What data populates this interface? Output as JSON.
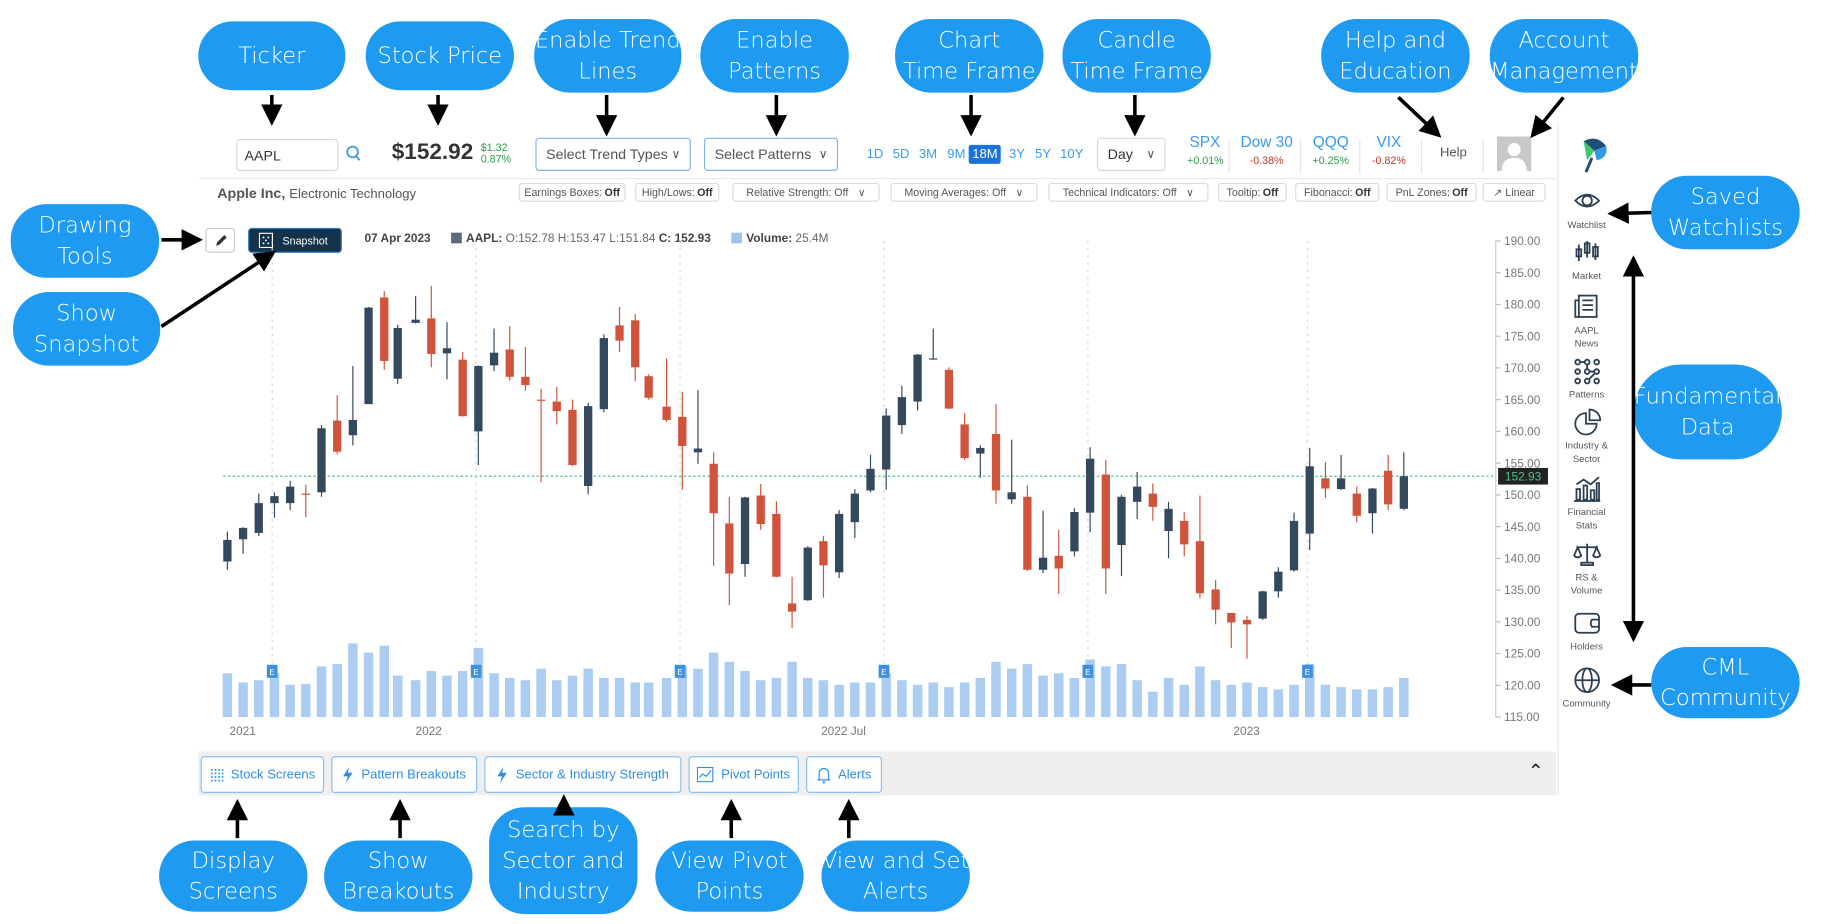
{
  "header": {
    "ticker_value": "AAPL",
    "price": "$152.92",
    "change_abs": "$1.32",
    "change_pct": "0.87%",
    "trend_select": "Select Trend Types",
    "pattern_select": "Select Patterns",
    "timeframes": [
      "1D",
      "5D",
      "3M",
      "9M",
      "18M",
      "3Y",
      "5Y",
      "10Y"
    ],
    "active_timeframe": "18M",
    "candle_select": "Day",
    "indices": [
      {
        "name": "SPX",
        "change": "+0.01%",
        "dir": "up"
      },
      {
        "name": "Dow 30",
        "change": "-0.38%",
        "dir": "down"
      },
      {
        "name": "QQQ",
        "change": "+0.25%",
        "dir": "up"
      },
      {
        "name": "VIX",
        "change": "-0.82%",
        "dir": "down"
      }
    ],
    "help": "Help"
  },
  "company": {
    "name": "Apple Inc,",
    "sector": "Electronic Technology"
  },
  "toggles": [
    {
      "label": "Earnings Boxes:",
      "value": "Off"
    },
    {
      "label": "High/Lows:",
      "value": "Off"
    },
    {
      "label": "Relative Strength: Off",
      "value": "",
      "dropdown": true
    },
    {
      "label": "Moving Averages: Off",
      "value": "",
      "dropdown": true
    },
    {
      "label": "Technical Indicators: Off",
      "value": "",
      "dropdown": true
    },
    {
      "label": "Tooltip:",
      "value": "Off"
    },
    {
      "label": "Fibonacci:",
      "value": "Off"
    },
    {
      "label": "PnL Zones:",
      "value": "Off"
    },
    {
      "label": "↗ Linear",
      "value": ""
    }
  ],
  "chart_toolbar": {
    "snapshot": "Snapshot",
    "date": "07 Apr 2023",
    "symbol": "AAPL:",
    "ohlc": "O:152.78 H:153.47 L:151.84",
    "close_label": "C:",
    "close_value": "152.93",
    "volume_label": "Volume:",
    "volume_value": "25.4M"
  },
  "sidebar": [
    {
      "label": "Watchlist",
      "icon": "eye-icon"
    },
    {
      "label": "Market",
      "icon": "candlestick-icon"
    },
    {
      "label": "AAPL\nNews",
      "icon": "newspaper-icon"
    },
    {
      "label": "Patterns",
      "icon": "pattern-icon"
    },
    {
      "label": "Industry &\nSector",
      "icon": "pie-chart-icon"
    },
    {
      "label": "Financial\nStats",
      "icon": "bar-chart-icon"
    },
    {
      "label": "RS &\nVolume",
      "icon": "scale-icon"
    },
    {
      "label": "Holders",
      "icon": "wallet-icon"
    },
    {
      "label": "Community",
      "icon": "globe-icon"
    }
  ],
  "bottom_bar": [
    {
      "label": "Stock Screens",
      "icon": "grid-dots-icon"
    },
    {
      "label": "Pattern Breakouts",
      "icon": "lightning-icon"
    },
    {
      "label": "Sector & Industry Strength",
      "icon": "lightning-icon"
    },
    {
      "label": "Pivot Points",
      "icon": "line-chart-icon"
    },
    {
      "label": "Alerts",
      "icon": "bell-icon"
    }
  ],
  "annotations": {
    "ticker": "Ticker",
    "stock_price": "Stock Price",
    "trend": "Enable Trend\nLines",
    "patterns": "Enable\nPatterns",
    "chart_tf": "Chart\nTime Frame",
    "candle_tf": "Candle\nTime Frame",
    "help": "Help and\nEducation",
    "account": "Account\nManagement",
    "drawing": "Drawing\nTools",
    "snapshot": "Show\nSnapshot",
    "watchlists": "Saved\nWatchlists",
    "fundamental": "Fundamental\nData",
    "community": "CML\nCommunity",
    "screens": "Display\nScreens",
    "breakouts": "Show\nBreakouts",
    "sector": "Search by\nSector and\nIndustry",
    "pivot": "View Pivot\nPoints",
    "alerts": "View and Set\nAlerts"
  },
  "colors": {
    "accent": "#1e9bf0",
    "up": "#34495e",
    "down": "#d0543c",
    "volume": "#9cc4ef",
    "last_price": "#4cc38a",
    "positive": "#2e9b48",
    "negative": "#c0392b"
  },
  "chart_data": {
    "type": "candlestick",
    "symbol": "AAPL",
    "interval": "weekly (approx. read from daily chart)",
    "ylim": [
      115,
      190
    ],
    "yticks": [
      "190.00",
      "185.00",
      "180.00",
      "175.00",
      "170.00",
      "165.00",
      "160.00",
      "155.00",
      "150.00",
      "145.00",
      "140.00",
      "135.00",
      "130.00",
      "125.00",
      "120.00",
      "115.00"
    ],
    "xtick_labels": [
      {
        "label": "2021",
        "date": "2021-10-10"
      },
      {
        "label": "2022",
        "date": "2022-01-01"
      },
      {
        "label": "2022 Jul",
        "date": "2022-07-01"
      },
      {
        "label": "2023",
        "date": "2023-01-01"
      }
    ],
    "last_price": 152.93,
    "last_price_label": "152.93",
    "earnings_marker": "E",
    "earnings_dates": [
      "2021-10-28",
      "2022-01-27",
      "2022-04-28",
      "2022-07-28",
      "2022-10-27",
      "2023-02-02"
    ],
    "candles": [
      [
        "2021-10-08",
        139.5,
        144.2,
        138.2,
        142.9,
        95
      ],
      [
        "2021-10-15",
        143,
        144.9,
        140.7,
        144.8,
        75
      ],
      [
        "2021-10-22",
        144,
        150.2,
        143.5,
        148.7,
        80
      ],
      [
        "2021-10-29",
        148.7,
        150.4,
        146.4,
        149.8,
        95
      ],
      [
        "2021-11-05",
        148.7,
        152.2,
        147.6,
        151.3,
        70
      ],
      [
        "2021-11-12",
        150.2,
        151.6,
        146.5,
        150,
        72
      ],
      [
        "2021-11-19",
        150.4,
        161,
        149.7,
        160.5,
        110
      ],
      [
        "2021-11-26",
        161.7,
        165.7,
        156.4,
        156.8,
        115
      ],
      [
        "2021-12-03",
        159.4,
        170.3,
        157.8,
        161.8,
        160
      ],
      [
        "2021-12-10",
        164.3,
        179.6,
        164.3,
        179.5,
        140
      ],
      [
        "2021-12-17",
        181.1,
        182.1,
        169.7,
        171.1,
        155
      ],
      [
        "2021-12-23",
        168.3,
        176.8,
        167.5,
        176.3,
        90
      ],
      [
        "2021-12-31",
        177.1,
        181.3,
        177,
        177.6,
        80
      ],
      [
        "2022-01-07",
        177.8,
        182.9,
        170.1,
        172.2,
        100
      ],
      [
        "2022-01-14",
        172.3,
        177.2,
        168.2,
        173.1,
        90
      ],
      [
        "2022-01-21",
        171.3,
        172.5,
        162.3,
        162.4,
        100
      ],
      [
        "2022-01-28",
        160,
        170.4,
        154.7,
        170.3,
        150
      ],
      [
        "2022-02-04",
        170.4,
        176.2,
        169.5,
        172.4,
        95
      ],
      [
        "2022-02-11",
        172.9,
        176.6,
        168,
        168.6,
        85
      ],
      [
        "2022-02-18",
        168.6,
        173.3,
        166.4,
        167.3,
        80
      ],
      [
        "2022-02-25",
        165,
        166.7,
        152,
        164.9,
        105
      ],
      [
        "2022-03-04",
        164.7,
        167,
        161.1,
        163.2,
        80
      ],
      [
        "2022-03-11",
        163.4,
        165,
        154.5,
        154.7,
        90
      ],
      [
        "2022-03-18",
        151.4,
        164.5,
        150.1,
        163.98,
        105
      ],
      [
        "2022-03-25",
        163.5,
        175.3,
        163,
        174.7,
        85
      ],
      [
        "2022-04-01",
        176.7,
        179.6,
        172.5,
        174.3,
        85
      ],
      [
        "2022-04-08",
        177.5,
        178.5,
        167.9,
        170.1,
        75
      ],
      [
        "2022-04-14",
        168.7,
        169,
        165,
        165.3,
        75
      ],
      [
        "2022-04-22",
        163.9,
        171.5,
        161.5,
        161.8,
        85
      ],
      [
        "2022-04-29",
        162.3,
        166.2,
        150.8,
        157.7,
        110
      ],
      [
        "2022-05-06",
        156.7,
        166.5,
        154.9,
        157.3,
        105
      ],
      [
        "2022-05-13",
        154.9,
        156.7,
        138.8,
        147.1,
        140
      ],
      [
        "2022-05-20",
        145.5,
        149.7,
        132.6,
        137.6,
        120
      ],
      [
        "2022-05-27",
        139.1,
        149.7,
        137.1,
        149.6,
        100
      ],
      [
        "2022-06-03",
        149.9,
        151.7,
        144.5,
        145.4,
        80
      ],
      [
        "2022-06-10",
        147,
        149,
        137,
        137.1,
        85
      ],
      [
        "2022-06-17",
        132.9,
        137.1,
        129,
        131.6,
        120
      ],
      [
        "2022-06-24",
        133.4,
        141.9,
        133.3,
        141.7,
        85
      ],
      [
        "2022-07-01",
        142.7,
        143.5,
        133.8,
        138.9,
        80
      ],
      [
        "2022-07-08",
        137.8,
        147.6,
        136.9,
        147,
        70
      ],
      [
        "2022-07-15",
        145.7,
        150.9,
        143.2,
        150.2,
        75
      ],
      [
        "2022-07-22",
        150.7,
        156.3,
        150.4,
        154.1,
        75
      ],
      [
        "2022-07-29",
        154,
        163.6,
        150.8,
        162.5,
        95
      ],
      [
        "2022-08-05",
        161,
        167.2,
        159.6,
        165.4,
        80
      ],
      [
        "2022-08-12",
        164.7,
        172.2,
        163.3,
        172.1,
        70
      ],
      [
        "2022-08-19",
        171.5,
        176.2,
        171.3,
        171.5,
        75
      ],
      [
        "2022-08-26",
        169.7,
        170.1,
        163.5,
        163.6,
        65
      ],
      [
        "2022-09-02",
        161.1,
        162.9,
        155.5,
        155.8,
        75
      ],
      [
        "2022-09-09",
        156.5,
        157.8,
        152.7,
        157.4,
        85
      ],
      [
        "2022-09-16",
        159.6,
        164.3,
        148.6,
        150.7,
        120
      ],
      [
        "2022-09-23",
        149.3,
        158.7,
        148.6,
        150.4,
        105
      ],
      [
        "2022-09-30",
        149.7,
        151.5,
        138,
        138.2,
        115
      ],
      [
        "2022-10-07",
        138.2,
        147.5,
        137.7,
        140.1,
        90
      ],
      [
        "2022-10-14",
        140.4,
        144.5,
        134.4,
        138.4,
        95
      ],
      [
        "2022-10-21",
        141.1,
        147.9,
        140.3,
        147.3,
        85
      ],
      [
        "2022-10-28",
        147.2,
        157.5,
        144.1,
        155.7,
        125
      ],
      [
        "2022-11-04",
        153.2,
        155.5,
        134.4,
        138.4,
        110
      ],
      [
        "2022-11-11",
        142.1,
        150,
        137.2,
        149.7,
        115
      ],
      [
        "2022-11-18",
        148.9,
        153.6,
        146.2,
        151.3,
        80
      ],
      [
        "2022-11-25",
        150.2,
        151.8,
        145.9,
        148.1,
        55
      ],
      [
        "2022-12-02",
        144.3,
        148.9,
        140,
        147.8,
        85
      ],
      [
        "2022-12-09",
        145.9,
        147.3,
        140.3,
        142.2,
        70
      ],
      [
        "2022-12-16",
        142.7,
        149.9,
        133.7,
        134.5,
        110
      ],
      [
        "2022-12-23",
        135.1,
        136.6,
        129.6,
        131.9,
        80
      ],
      [
        "2022-12-30",
        131.4,
        131.4,
        125.9,
        129.9,
        70
      ],
      [
        "2023-01-06",
        130.3,
        130.9,
        124.2,
        129.6,
        75
      ],
      [
        "2023-01-13",
        130.5,
        134.9,
        130.3,
        134.8,
        65
      ],
      [
        "2023-01-20",
        134.8,
        138.6,
        133.8,
        137.9,
        60
      ],
      [
        "2023-01-27",
        138.1,
        147.2,
        137.9,
        145.9,
        70
      ],
      [
        "2023-02-03",
        143.9,
        157.4,
        141.3,
        154.5,
        115
      ],
      [
        "2023-02-10",
        152.6,
        155.2,
        149.5,
        151,
        70
      ],
      [
        "2023-02-17",
        150.9,
        156.3,
        150.8,
        152.6,
        65
      ],
      [
        "2023-02-24",
        150.2,
        151.3,
        145.7,
        146.7,
        60
      ],
      [
        "2023-03-03",
        147.1,
        151.1,
        143.9,
        151,
        60
      ],
      [
        "2023-03-10",
        153.8,
        156.3,
        147.6,
        148.5,
        65
      ],
      [
        "2023-03-17",
        147.8,
        156.7,
        147.6,
        152.93,
        85
      ]
    ]
  }
}
